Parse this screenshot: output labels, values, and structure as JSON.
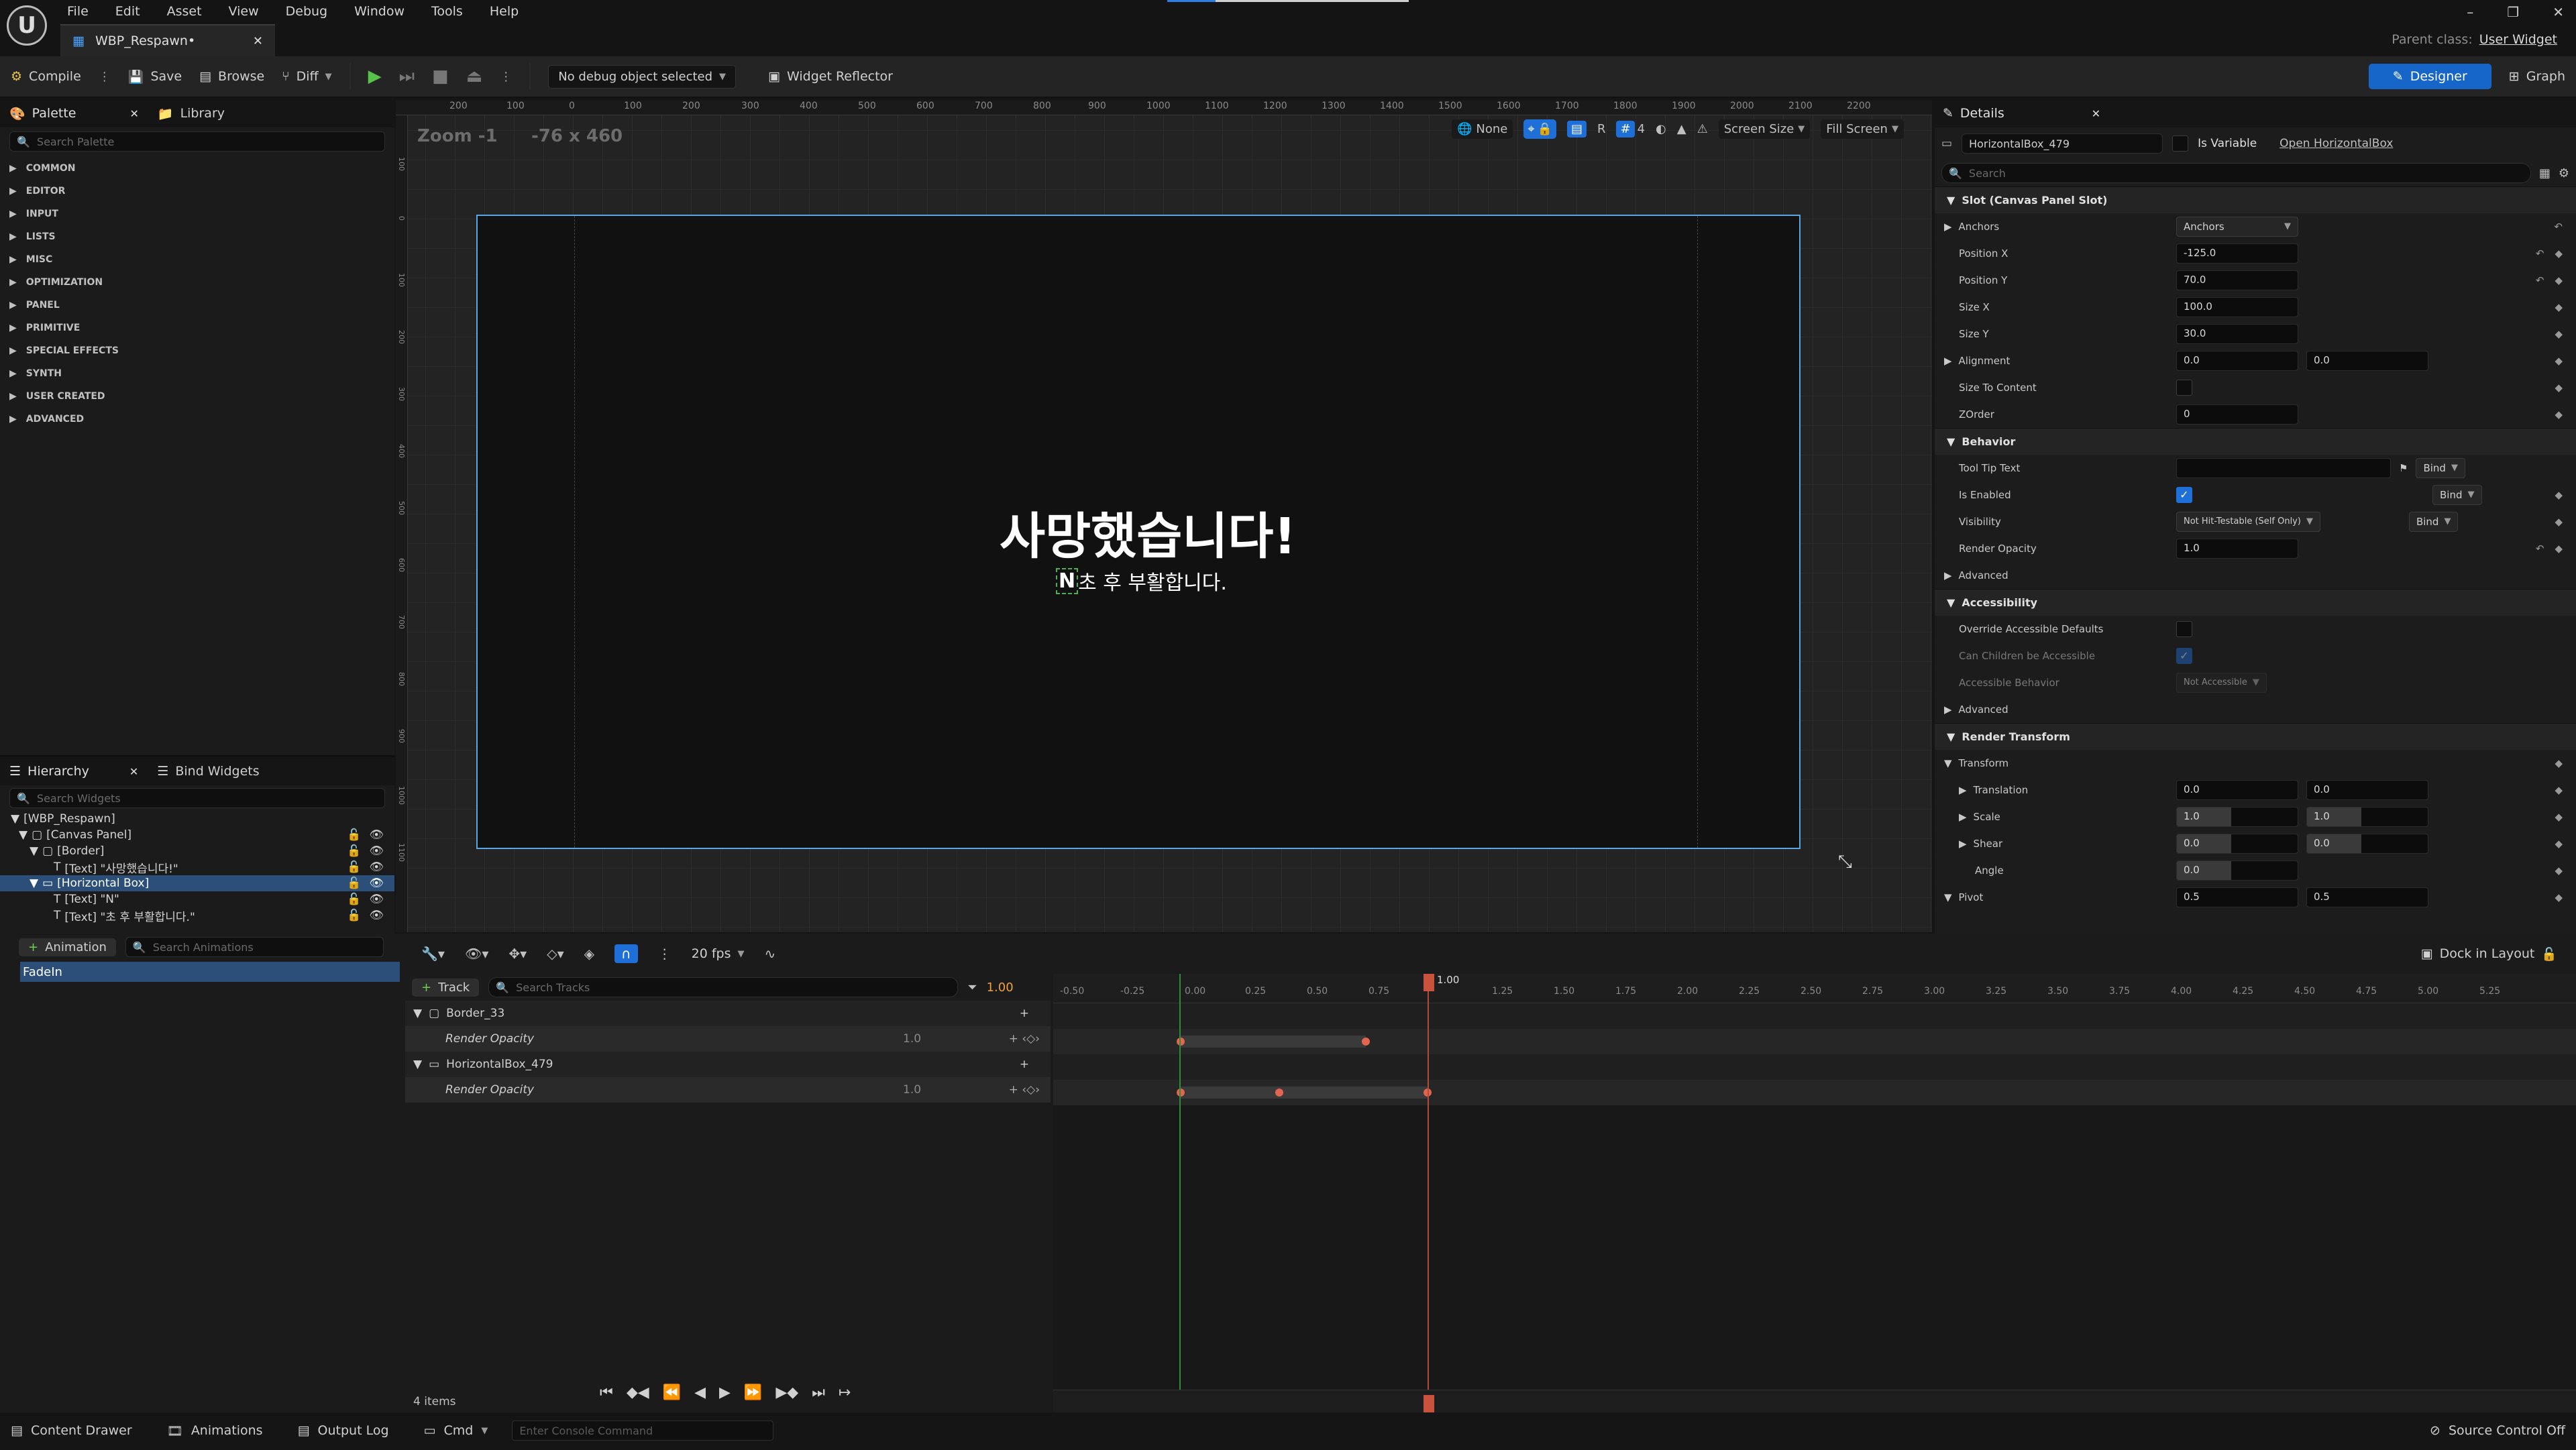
{
  "menu": [
    "File",
    "Edit",
    "Asset",
    "View",
    "Debug",
    "Window",
    "Tools",
    "Help"
  ],
  "tab": {
    "title": "WBP_Respawn•"
  },
  "parent_class": {
    "label": "Parent class:",
    "value": "User Widget"
  },
  "toolbar": {
    "compile": "Compile",
    "save": "Save",
    "browse": "Browse",
    "diff": "Diff",
    "debug_object": "No debug object selected",
    "widget_reflector": "Widget Reflector",
    "designer": "Designer",
    "graph": "Graph"
  },
  "palette": {
    "tab": "Palette",
    "library_tab": "Library",
    "search_placeholder": "Search Palette",
    "categories": [
      "COMMON",
      "EDITOR",
      "INPUT",
      "LISTS",
      "MISC",
      "OPTIMIZATION",
      "PANEL",
      "PRIMITIVE",
      "SPECIAL EFFECTS",
      "SYNTH",
      "USER CREATED",
      "ADVANCED"
    ]
  },
  "hierarchy": {
    "tab": "Hierarchy",
    "bind_tab": "Bind Widgets",
    "search_placeholder": "Search Widgets",
    "items": [
      "[WBP_Respawn]",
      "[Canvas Panel]",
      "[Border]",
      "[Text] \"사망했습니다!\"",
      "[Horizontal Box]",
      "[Text] \"N\"",
      "[Text] \"초 후 부활합니다.\""
    ]
  },
  "canvas": {
    "zoom": "Zoom -1",
    "coords": "-76 x 460",
    "none": "None",
    "grid_num": "4",
    "screen_size": "Screen Size",
    "fill_screen": "Fill Screen",
    "r_label": "R",
    "title_text": "사망했습니다!",
    "n_text": "N",
    "sub_text": "초 후 부활합니다.",
    "ruler_h": [
      "200",
      "100",
      "0",
      "100",
      "200",
      "300",
      "400",
      "500",
      "600",
      "700",
      "800",
      "900",
      "1000",
      "1100",
      "1200",
      "1300",
      "1400",
      "1500",
      "1600",
      "1700",
      "1800",
      "1900",
      "2000",
      "2100",
      "2200"
    ],
    "ruler_v": [
      "100",
      "0",
      "100",
      "200",
      "300",
      "400",
      "500",
      "600",
      "700",
      "800",
      "900",
      "1000",
      "1100"
    ]
  },
  "details": {
    "tab": "Details",
    "widget_name": "HorizontalBox_479",
    "is_variable": "Is Variable",
    "open_link": "Open HorizontalBox",
    "search_placeholder": "Search",
    "slot_section": "Slot (Canvas Panel Slot)",
    "anchors_label": "Anchors",
    "anchors_value": "Anchors",
    "pos_x_label": "Position X",
    "pos_x": "-125.0",
    "pos_y_label": "Position Y",
    "pos_y": "70.0",
    "size_x_label": "Size X",
    "size_x": "100.0",
    "size_y_label": "Size Y",
    "size_y": "30.0",
    "alignment_label": "Alignment",
    "align_x": "0.0",
    "align_y": "0.0",
    "size_to_content_label": "Size To Content",
    "zorder_label": "ZOrder",
    "zorder": "0",
    "behavior_section": "Behavior",
    "tooltip_label": "Tool Tip Text",
    "bind": "Bind",
    "is_enabled_label": "Is Enabled",
    "visibility_label": "Visibility",
    "visibility": "Not Hit-Testable (Self Only)",
    "render_opacity_label": "Render Opacity",
    "render_opacity": "1.0",
    "advanced": "Advanced",
    "accessibility_section": "Accessibility",
    "override_label": "Override Accessible Defaults",
    "children_label": "Can Children be Accessible",
    "acc_behavior_label": "Accessible Behavior",
    "acc_behavior": "Not Accessible",
    "render_transform_section": "Render Transform",
    "transform_label": "Transform",
    "translation_label": "Translation",
    "tr_x": "0.0",
    "tr_y": "0.0",
    "scale_label": "Scale",
    "sc_x": "1.0",
    "sc_y": "1.0",
    "shear_label": "Shear",
    "sh_x": "0.0",
    "sh_y": "0.0",
    "angle_label": "Angle",
    "angle": "0.0",
    "pivot_label": "Pivot",
    "pv_x": "0.5",
    "pv_y": "0.5"
  },
  "animation": {
    "add_label": "Animation",
    "search_placeholder": "Search Animations",
    "items": [
      "FadeIn"
    ]
  },
  "sequencer": {
    "fps": "20 fps",
    "track_label": "Track",
    "search_placeholder": "Search Tracks",
    "time": "1.00",
    "playhead": "1.00",
    "dock": "Dock in Layout",
    "items_count": "4 items",
    "tracks": [
      {
        "name": "Border_33",
        "child": "Render Opacity",
        "value": "1.0"
      },
      {
        "name": "HorizontalBox_479",
        "child": "Render Opacity",
        "value": "1.0"
      }
    ],
    "ticks": [
      "-0.50",
      "-0.25",
      "0.00",
      "0.25",
      "0.50",
      "0.75",
      "1.00",
      "1.25",
      "1.50",
      "1.75",
      "2.00",
      "2.25",
      "2.50",
      "2.75",
      "3.00",
      "3.25",
      "3.50",
      "3.75",
      "4.00",
      "4.25",
      "4.50",
      "4.75",
      "5.00",
      "5.25"
    ]
  },
  "statusbar": {
    "content_drawer": "Content Drawer",
    "animations": "Animations",
    "output_log": "Output Log",
    "cmd": "Cmd",
    "console_placeholder": "Enter Console Command",
    "source_control": "Source Control Off"
  }
}
